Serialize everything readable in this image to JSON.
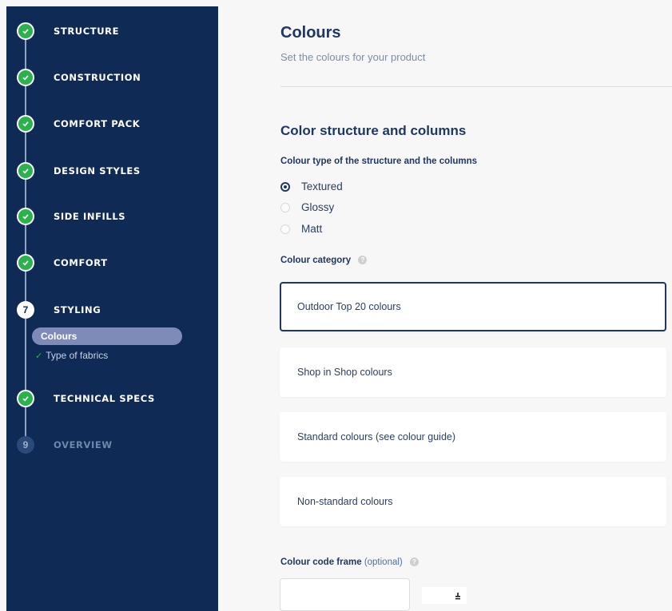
{
  "sidebar": {
    "steps": [
      {
        "number": "",
        "label": "STRUCTURE",
        "state": "done"
      },
      {
        "number": "",
        "label": "CONSTRUCTION",
        "state": "done"
      },
      {
        "number": "",
        "label": "COMFORT PACK",
        "state": "done"
      },
      {
        "number": "",
        "label": "DESIGN STYLES",
        "state": "done"
      },
      {
        "number": "",
        "label": "SIDE INFILLS",
        "state": "done"
      },
      {
        "number": "",
        "label": "COMFORT",
        "state": "done"
      },
      {
        "number": "7",
        "label": "STYLING",
        "state": "current"
      },
      {
        "number": "",
        "label": "TECHNICAL SPECS",
        "state": "done"
      },
      {
        "number": "9",
        "label": "OVERVIEW",
        "state": "future"
      }
    ],
    "substeps": [
      {
        "label": "Colours",
        "state": "active"
      },
      {
        "label": "Type of fabrics",
        "state": "done"
      }
    ],
    "check_glyph": "✓"
  },
  "main": {
    "title": "Colours",
    "subtitle": "Set the colours for your product",
    "section_title": "Color structure and columns",
    "colour_type_label": "Colour type of the structure and the columns",
    "colour_type_options": [
      {
        "label": "Textured",
        "checked": true
      },
      {
        "label": "Glossy",
        "checked": false
      },
      {
        "label": "Matt",
        "checked": false
      }
    ],
    "colour_category_label": "Colour category",
    "colour_categories": [
      {
        "label": "Outdoor Top 20 colours",
        "selected": true
      },
      {
        "label": "Shop in Shop colours",
        "selected": false
      },
      {
        "label": "Standard colours (see colour guide)",
        "selected": false
      },
      {
        "label": "Non-standard colours",
        "selected": false
      }
    ],
    "frame_label": "Colour code frame",
    "frame_optional": "(optional)",
    "frame_value": "",
    "help_glyph": "?"
  },
  "colors": {
    "sidebar_bg": "#0f2a55",
    "done_green": "#2bb24c",
    "primary_text": "#1f3764",
    "active_substep": "#7e8bb8"
  }
}
